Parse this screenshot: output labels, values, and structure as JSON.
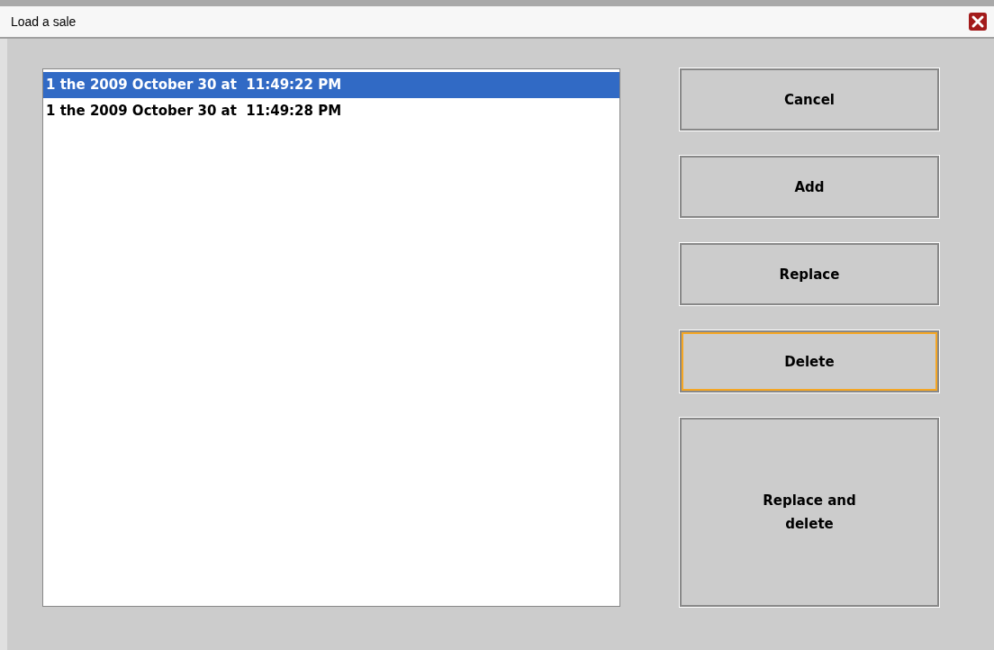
{
  "window": {
    "title": "Load a sale"
  },
  "sales": [
    {
      "label": "1 the 2009 October 30 at  11:49:22 PM",
      "selected": true
    },
    {
      "label": "1 the 2009 October 30 at  11:49:28 PM",
      "selected": false
    }
  ],
  "buttons": [
    {
      "label": "Cancel",
      "focused": false,
      "tall": false
    },
    {
      "label": "Add",
      "focused": false,
      "tall": false
    },
    {
      "label": "Replace",
      "focused": false,
      "tall": false
    },
    {
      "label": "Delete",
      "focused": true,
      "tall": false
    },
    {
      "label": "Replace and delete",
      "focused": false,
      "tall": true
    }
  ]
}
